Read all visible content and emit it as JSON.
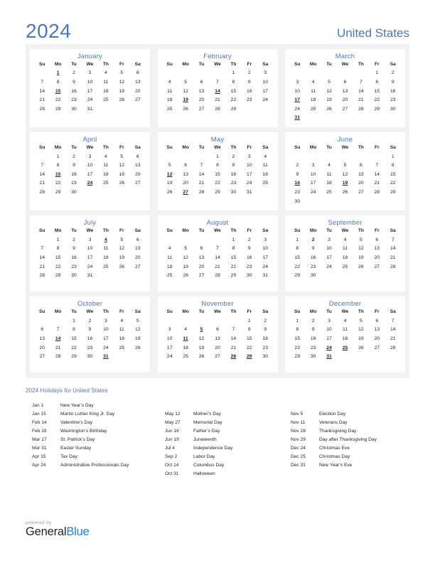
{
  "header": {
    "year": "2024",
    "country": "United States"
  },
  "weekday_headers": [
    "Su",
    "Mo",
    "Tu",
    "We",
    "Th",
    "Fr",
    "Sa"
  ],
  "colors": {
    "accent_blue": "#4a77c4",
    "holiday_red": "#e8000d",
    "panel_bg": "#f2f2f2",
    "card_bg": "#ffffff",
    "brand_blue": "#1f7fd4"
  },
  "months": [
    {
      "name": "January",
      "weeks": [
        [
          "",
          "1",
          "2",
          "3",
          "4",
          "5",
          "6"
        ],
        [
          "7",
          "8",
          "9",
          "10",
          "11",
          "12",
          "13"
        ],
        [
          "14",
          "15",
          "16",
          "17",
          "18",
          "19",
          "20"
        ],
        [
          "21",
          "22",
          "23",
          "24",
          "25",
          "26",
          "27"
        ],
        [
          "28",
          "29",
          "30",
          "31",
          "",
          "",
          ""
        ]
      ],
      "holidays": [
        "1",
        "15"
      ],
      "holidays_plain": []
    },
    {
      "name": "February",
      "weeks": [
        [
          "",
          "",
          "",
          "",
          "1",
          "2",
          "3"
        ],
        [
          "4",
          "5",
          "6",
          "7",
          "8",
          "9",
          "10"
        ],
        [
          "11",
          "12",
          "13",
          "14",
          "15",
          "16",
          "17"
        ],
        [
          "18",
          "19",
          "20",
          "21",
          "22",
          "23",
          "24"
        ],
        [
          "25",
          "26",
          "27",
          "28",
          "29",
          "",
          ""
        ]
      ],
      "holidays": [
        "14",
        "19"
      ],
      "holidays_plain": []
    },
    {
      "name": "March",
      "weeks": [
        [
          "",
          "",
          "",
          "",
          "",
          "1",
          "2"
        ],
        [
          "3",
          "4",
          "5",
          "6",
          "7",
          "8",
          "9"
        ],
        [
          "10",
          "11",
          "12",
          "13",
          "14",
          "15",
          "16"
        ],
        [
          "17",
          "18",
          "19",
          "20",
          "21",
          "22",
          "23"
        ],
        [
          "24",
          "25",
          "26",
          "27",
          "28",
          "29",
          "30"
        ],
        [
          "31",
          "",
          "",
          "",
          "",
          "",
          ""
        ]
      ],
      "holidays": [
        "17",
        "31"
      ],
      "holidays_plain": []
    },
    {
      "name": "April",
      "weeks": [
        [
          "",
          "1",
          "2",
          "3",
          "4",
          "5",
          "6"
        ],
        [
          "7",
          "8",
          "9",
          "10",
          "11",
          "12",
          "13"
        ],
        [
          "14",
          "15",
          "16",
          "17",
          "18",
          "19",
          "20"
        ],
        [
          "21",
          "22",
          "23",
          "24",
          "25",
          "26",
          "27"
        ],
        [
          "28",
          "29",
          "30",
          "",
          "",
          "",
          ""
        ]
      ],
      "holidays": [
        "15",
        "24"
      ],
      "holidays_plain": []
    },
    {
      "name": "May",
      "weeks": [
        [
          "",
          "",
          "",
          "1",
          "2",
          "3",
          "4"
        ],
        [
          "5",
          "6",
          "7",
          "8",
          "9",
          "10",
          "11"
        ],
        [
          "12",
          "13",
          "14",
          "15",
          "16",
          "17",
          "18"
        ],
        [
          "19",
          "20",
          "21",
          "22",
          "23",
          "24",
          "25"
        ],
        [
          "26",
          "27",
          "28",
          "29",
          "30",
          "31",
          ""
        ]
      ],
      "holidays": [
        "12",
        "27"
      ],
      "holidays_plain": []
    },
    {
      "name": "June",
      "weeks": [
        [
          "",
          "",
          "",
          "",
          "",
          "",
          "1"
        ],
        [
          "2",
          "3",
          "4",
          "5",
          "6",
          "7",
          "8"
        ],
        [
          "9",
          "10",
          "11",
          "12",
          "13",
          "14",
          "15"
        ],
        [
          "16",
          "17",
          "18",
          "19",
          "20",
          "21",
          "22"
        ],
        [
          "23",
          "24",
          "25",
          "26",
          "27",
          "28",
          "29"
        ],
        [
          "30",
          "",
          "",
          "",
          "",
          "",
          ""
        ]
      ],
      "holidays": [
        "16",
        "19"
      ],
      "holidays_plain": []
    },
    {
      "name": "July",
      "weeks": [
        [
          "",
          "1",
          "2",
          "3",
          "4",
          "5",
          "6"
        ],
        [
          "7",
          "8",
          "9",
          "10",
          "11",
          "12",
          "13"
        ],
        [
          "14",
          "15",
          "16",
          "17",
          "18",
          "19",
          "20"
        ],
        [
          "21",
          "22",
          "23",
          "24",
          "25",
          "26",
          "27"
        ],
        [
          "28",
          "29",
          "30",
          "31",
          "",
          "",
          ""
        ]
      ],
      "holidays": [
        "4"
      ],
      "holidays_plain": []
    },
    {
      "name": "August",
      "weeks": [
        [
          "",
          "",
          "",
          "",
          "1",
          "2",
          "3"
        ],
        [
          "4",
          "5",
          "6",
          "7",
          "8",
          "9",
          "10"
        ],
        [
          "11",
          "12",
          "13",
          "14",
          "15",
          "16",
          "17"
        ],
        [
          "18",
          "19",
          "20",
          "21",
          "22",
          "23",
          "24"
        ],
        [
          "25",
          "26",
          "27",
          "28",
          "29",
          "30",
          "31"
        ]
      ],
      "holidays": [],
      "holidays_plain": []
    },
    {
      "name": "September",
      "weeks": [
        [
          "1",
          "2",
          "3",
          "4",
          "5",
          "6",
          "7"
        ],
        [
          "8",
          "9",
          "10",
          "11",
          "12",
          "13",
          "14"
        ],
        [
          "15",
          "16",
          "17",
          "18",
          "19",
          "20",
          "21"
        ],
        [
          "22",
          "23",
          "24",
          "25",
          "26",
          "27",
          "28"
        ],
        [
          "29",
          "30",
          "",
          "",
          "",
          "",
          ""
        ]
      ],
      "holidays": [],
      "holidays_plain": [
        "2"
      ]
    },
    {
      "name": "October",
      "weeks": [
        [
          "",
          "",
          "1",
          "2",
          "3",
          "4",
          "5"
        ],
        [
          "6",
          "7",
          "8",
          "9",
          "10",
          "11",
          "12"
        ],
        [
          "13",
          "14",
          "15",
          "16",
          "17",
          "18",
          "19"
        ],
        [
          "20",
          "21",
          "22",
          "23",
          "24",
          "25",
          "26"
        ],
        [
          "27",
          "28",
          "29",
          "30",
          "31",
          "",
          ""
        ]
      ],
      "holidays": [
        "14",
        "31"
      ],
      "holidays_plain": []
    },
    {
      "name": "November",
      "weeks": [
        [
          "",
          "",
          "",
          "",
          "",
          "1",
          "2"
        ],
        [
          "3",
          "4",
          "5",
          "6",
          "7",
          "8",
          "9"
        ],
        [
          "10",
          "11",
          "12",
          "13",
          "14",
          "15",
          "16"
        ],
        [
          "17",
          "18",
          "19",
          "20",
          "21",
          "22",
          "23"
        ],
        [
          "24",
          "25",
          "26",
          "27",
          "28",
          "29",
          "30"
        ]
      ],
      "holidays": [
        "5",
        "11",
        "28",
        "29"
      ],
      "holidays_plain": []
    },
    {
      "name": "December",
      "weeks": [
        [
          "1",
          "2",
          "3",
          "4",
          "5",
          "6",
          "7"
        ],
        [
          "8",
          "9",
          "10",
          "11",
          "12",
          "13",
          "14"
        ],
        [
          "15",
          "16",
          "17",
          "18",
          "19",
          "20",
          "21"
        ],
        [
          "22",
          "23",
          "24",
          "25",
          "26",
          "27",
          "28"
        ],
        [
          "29",
          "30",
          "31",
          "",
          "",
          "",
          ""
        ]
      ],
      "holidays": [
        "24",
        "25",
        "31"
      ],
      "holidays_plain": []
    }
  ],
  "holidays_section": {
    "title": "2024 Holidays for United States",
    "columns": [
      [
        {
          "date": "Jan 1",
          "name": "New Year’s Day"
        },
        {
          "date": "Jan 15",
          "name": "Martin Luther King Jr. Day"
        },
        {
          "date": "Feb 14",
          "name": "Valentine’s Day"
        },
        {
          "date": "Feb 19",
          "name": "Washington’s Birthday"
        },
        {
          "date": "Mar 17",
          "name": "St. Patrick’s Day"
        },
        {
          "date": "Mar 31",
          "name": "Easter Sunday"
        },
        {
          "date": "Apr 15",
          "name": "Tax Day"
        },
        {
          "date": "Apr 24",
          "name": "Administrative Professionals Day"
        }
      ],
      [
        {
          "date": "May 12",
          "name": "Mother’s Day"
        },
        {
          "date": "May 27",
          "name": "Memorial Day"
        },
        {
          "date": "Jun 16",
          "name": "Father’s Day"
        },
        {
          "date": "Jun 19",
          "name": "Juneteenth"
        },
        {
          "date": "Jul 4",
          "name": "Independence Day"
        },
        {
          "date": "Sep 2",
          "name": "Labor Day"
        },
        {
          "date": "Oct 14",
          "name": "Columbus Day"
        },
        {
          "date": "Oct 31",
          "name": "Halloween"
        }
      ],
      [
        {
          "date": "Nov 5",
          "name": "Election Day"
        },
        {
          "date": "Nov 11",
          "name": "Veterans Day"
        },
        {
          "date": "Nov 28",
          "name": "Thanksgiving Day"
        },
        {
          "date": "Nov 29",
          "name": "Day after Thanksgiving Day"
        },
        {
          "date": "Dec 24",
          "name": "Christmas Eve"
        },
        {
          "date": "Dec 25",
          "name": "Christmas Day"
        },
        {
          "date": "Dec 31",
          "name": "New Year’s Eve"
        }
      ]
    ],
    "column_offsets": [
      0,
      1,
      1
    ]
  },
  "footer": {
    "powered_by": "powered by",
    "brand_first": "General",
    "brand_second": "Blue"
  }
}
